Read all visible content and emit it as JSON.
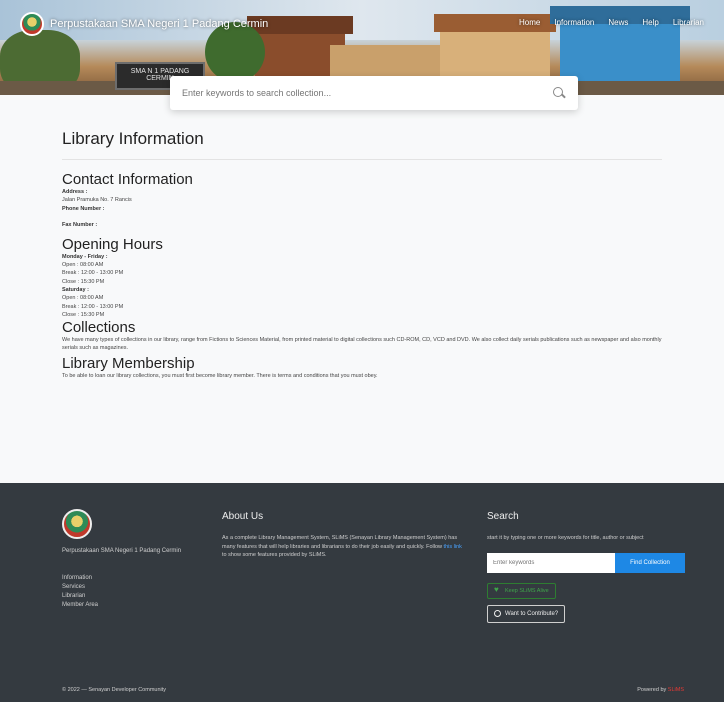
{
  "header": {
    "brand_name": "Perpustakaan SMA Negeri 1 Padang Cermin",
    "nav": [
      "Home",
      "Information",
      "News",
      "Help",
      "Librarian"
    ],
    "sign_text": "SMA N 1 PADANG CERMIN",
    "search_placeholder": "Enter keywords to search collection..."
  },
  "main": {
    "title": "Library Information",
    "contact": {
      "heading": "Contact Information",
      "address_label": "Address :",
      "address_value": "Jalan Pramuka No. 7 Rancis",
      "phone_label": "Phone Number :",
      "fax_label": "Fax Number :"
    },
    "hours": {
      "heading": "Opening Hours",
      "weekday_label": "Monday - Friday :",
      "weekday_open": "Open : 08:00 AM",
      "weekday_break": "Break : 12:00 - 13:00 PM",
      "weekday_close": "Close : 15:30 PM",
      "sat_label": "Saturday :",
      "sat_open": "Open : 08:00 AM",
      "sat_break": "Break : 12:00 - 13:00 PM",
      "sat_close": "Close : 15:30 PM"
    },
    "collections": {
      "heading": "Collections",
      "text": "We have many types of collections in our library, range from Fictions to Sciences Material, from printed material to digital collections such CD-ROM, CD, VCD and DVD. We also collect daily serials publications such as newspaper and also monthly serials such as magazines."
    },
    "membership": {
      "heading": "Library Membership",
      "text": "To be able to loan our library collections, you must first become library member. There is terms and conditions that you must obey."
    }
  },
  "footer": {
    "org_name": "Perpustakaan SMA Negeri 1 Padang Cermin",
    "links": [
      "Information",
      "Services",
      "Librarian",
      "Member Area"
    ],
    "about": {
      "heading": "About Us",
      "text_before": "As a complete Library Management System, SLiMS (Senayan Library Management System) has many features that will help libraries and librarians to do their job easily and quickly. Follow ",
      "link": "this link",
      "text_after": " to show some features provided by SLiMS."
    },
    "search": {
      "heading": "Search",
      "text": "start it by typing one or more keywords for title, author or subject",
      "placeholder": "Enter keywords",
      "button": "Find Collection",
      "love_button": "Keep SLiMS Alive",
      "contribute_button": "Want to Contribute?"
    },
    "copyright": "© 2022 — Senayan Developer Community",
    "powered_by": "Powered by",
    "powered_name": "SLiMS"
  }
}
